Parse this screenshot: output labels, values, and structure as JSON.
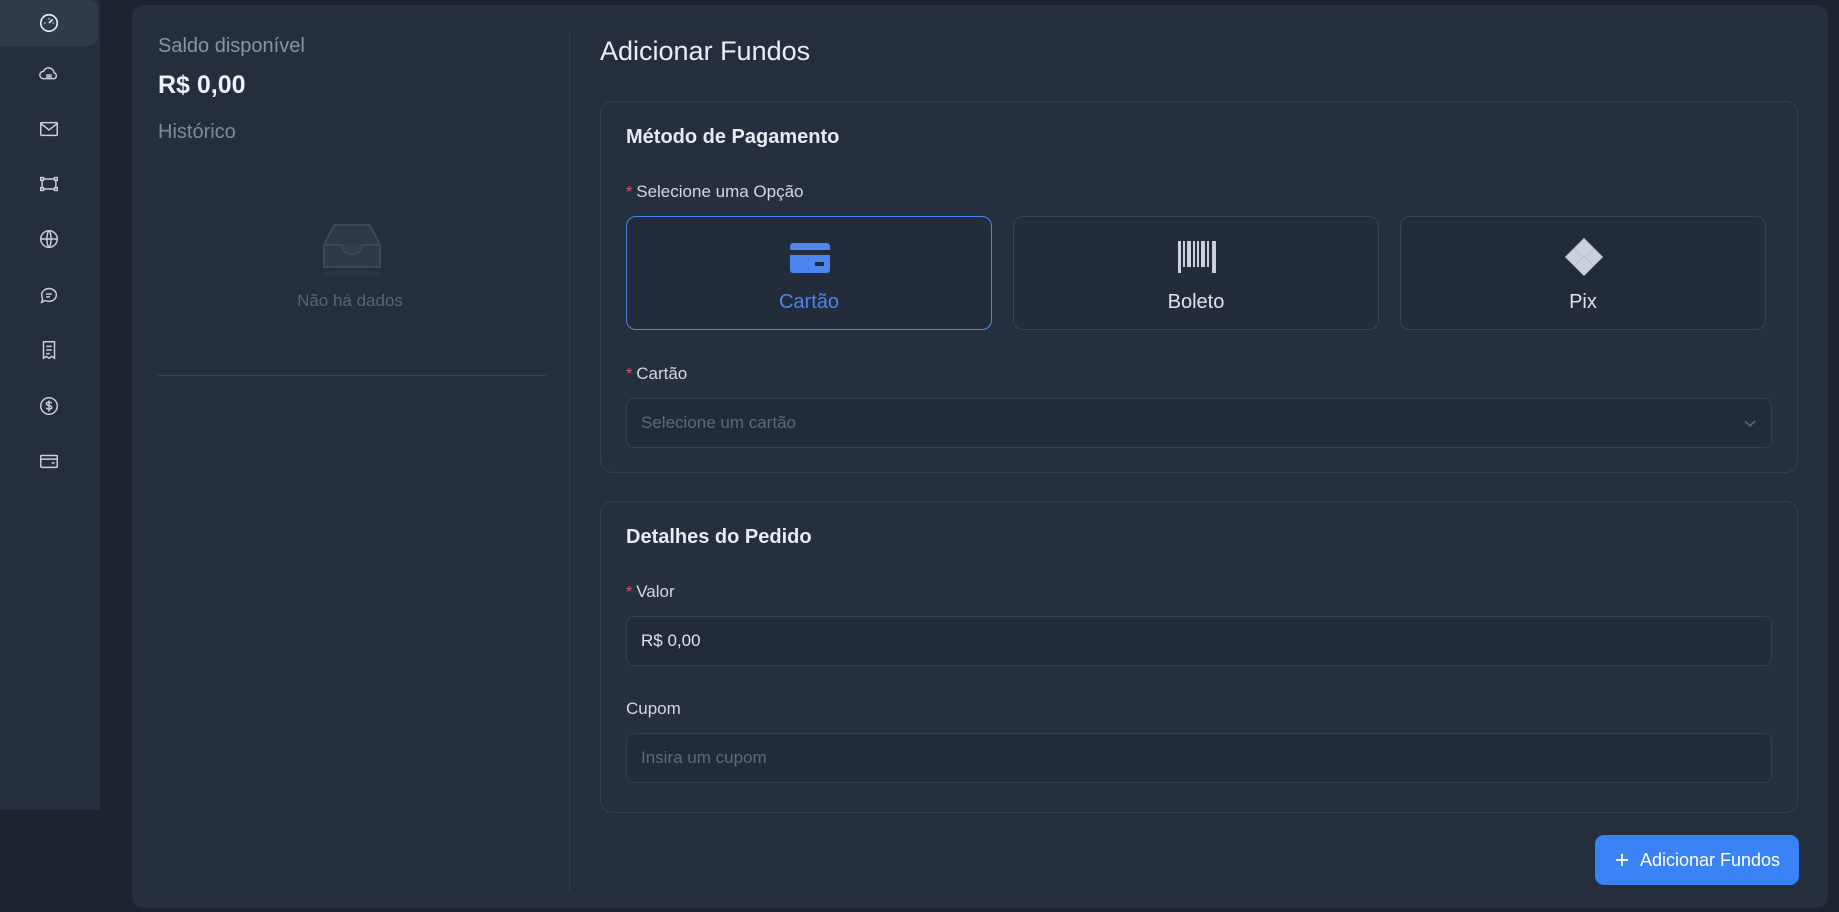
{
  "sidebar": {
    "icons": [
      "dashboard-icon",
      "cloud-network-icon",
      "mail-icon",
      "nodes-icon",
      "globe-icon",
      "chat-icon",
      "receipt-icon",
      "dollar-icon",
      "wallet-icon"
    ]
  },
  "balance": {
    "label": "Saldo disponível",
    "value": "R$ 0,00"
  },
  "history": {
    "title": "Histórico",
    "empty_text": "Não há dados"
  },
  "page": {
    "title": "Adicionar Fundos"
  },
  "payment": {
    "title": "Método de Pagamento",
    "option_label": "Selecione uma Opção",
    "options": [
      {
        "label": "Cartão",
        "icon": "credit-card-icon",
        "selected": true
      },
      {
        "label": "Boleto",
        "icon": "barcode-icon",
        "selected": false
      },
      {
        "label": "Pix",
        "icon": "pix-icon",
        "selected": false
      }
    ],
    "card_label": "Cartão",
    "card_placeholder": "Selecione um cartão"
  },
  "order": {
    "title": "Detalhes do Pedido",
    "value_label": "Valor",
    "value": "R$ 0,00",
    "coupon_label": "Cupom",
    "coupon_placeholder": "Insira um cupom"
  },
  "actions": {
    "submit_label": "Adicionar Fundos"
  },
  "colors": {
    "accent": "#3b82f6",
    "background": "#1b2330",
    "card": "#252e3d",
    "required": "#e05a5a"
  }
}
